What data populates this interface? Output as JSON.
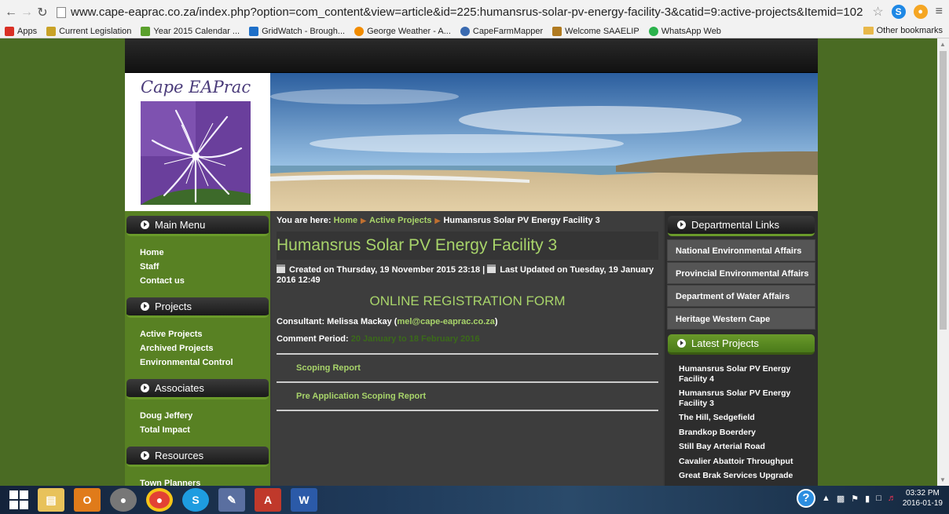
{
  "browser": {
    "url": "www.cape-eaprac.co.za/index.php?option=com_content&view=article&id=225:humansrus-solar-pv-energy-facility-3&catid=9:active-projects&Itemid=102",
    "bookmarks": [
      {
        "label": "Apps",
        "color": "#d93025"
      },
      {
        "label": "Current Legislation",
        "color": "#c9a227"
      },
      {
        "label": "Year 2015 Calendar ...",
        "color": "#5aa02c"
      },
      {
        "label": "GridWatch - Brough...",
        "color": "#1e6fc8"
      },
      {
        "label": "George Weather - A...",
        "color": "#f28c00"
      },
      {
        "label": "CapeFarmMapper",
        "color": "#3a6ab0"
      },
      {
        "label": "Welcome SAAELIP",
        "color": "#b07a20"
      },
      {
        "label": "WhatsApp Web",
        "color": "#2bb24c"
      }
    ],
    "other_bookmarks": "Other bookmarks"
  },
  "site": {
    "logo_text": "Cape EAPrac",
    "left_menu": [
      {
        "title": "Main Menu",
        "items": [
          "Home",
          "Staff",
          "Contact us"
        ]
      },
      {
        "title": "Projects",
        "items": [
          "Active Projects",
          "Archived Projects",
          "Environmental Control"
        ]
      },
      {
        "title": "Associates",
        "items": [
          "Doug Jeffery",
          "Total Impact"
        ]
      },
      {
        "title": "Resources",
        "items": [
          "Town Planners"
        ]
      }
    ],
    "breadcrumb": {
      "prefix": "You are here:",
      "home": "Home",
      "section": "Active Projects",
      "current": "Humansrus Solar PV Energy Facility 3"
    },
    "article": {
      "title": "Humansrus Solar PV Energy Facility 3",
      "created": "Created on Thursday, 19 November 2015 23:18 |",
      "updated": "Last Updated on Tuesday, 19 January 2016 12:49",
      "form_heading": "ONLINE REGISTRATION FORM",
      "consultant_label": "Consultant: Melissa Mackay (",
      "consultant_email": "mel@cape-eaprac.co.za",
      "consultant_close": ")",
      "comment_label": "Comment Period:",
      "comment_value": "20 January to 18 February 2016",
      "documents": [
        "Scoping Report",
        "Pre Application Scoping Report"
      ]
    },
    "right": {
      "dept_title": "Departmental Links",
      "dept_links": [
        "National Environmental Affairs",
        "Provincial Environmental Affairs",
        "Department of Water Affairs",
        "Heritage Western Cape"
      ],
      "latest_title": "Latest Projects",
      "latest": [
        "Humansrus Solar PV Energy Facility 4",
        "Humansrus Solar PV Energy Facility 3",
        "The Hill, Sedgefield",
        "Brandkop Boerdery",
        "Still Bay Arterial Road",
        "Cavalier Abattoir Throughput",
        "Great Brak Services Upgrade"
      ]
    }
  },
  "taskbar": {
    "time": "03:32 PM",
    "date": "2016-01-19"
  },
  "colors": {
    "accent_green": "#a8d46a",
    "page_bg": "#4a6b23",
    "menu_green": "#588123"
  }
}
